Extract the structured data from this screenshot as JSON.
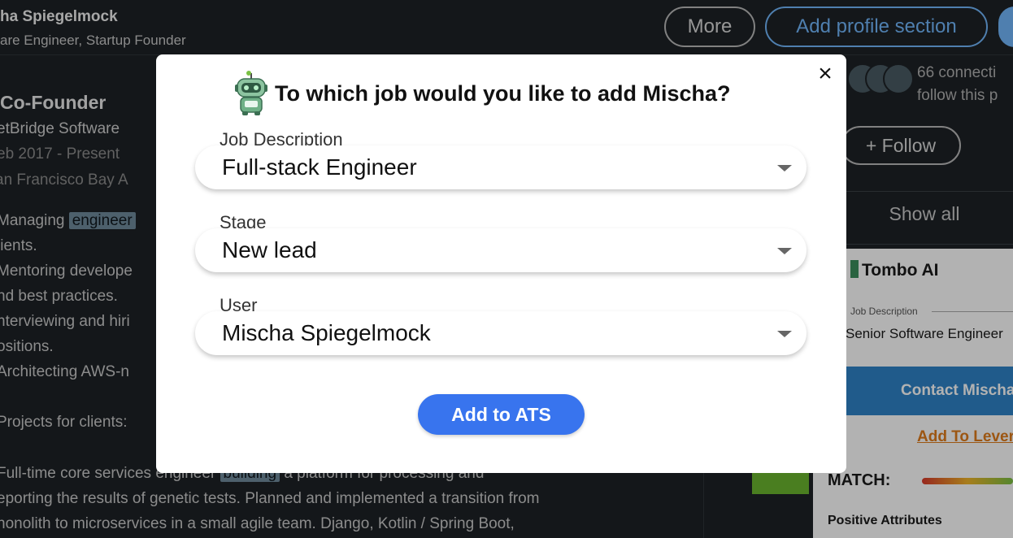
{
  "profile": {
    "name": "ha Spiegelmock",
    "headline": "are Engineer, Startup Founder",
    "more_label": "More",
    "add_section_label": "Add profile section"
  },
  "experience": {
    "title": "Co-Founder",
    "company": "etBridge Software",
    "dates": "eb 2017 - Present",
    "location": "an Francisco Bay A",
    "lines": [
      {
        "pre": "Managing ",
        "hl": "engineer",
        "post": ""
      },
      {
        "pre": "lients.",
        "hl": "",
        "post": ""
      },
      {
        "pre": "Mentoring develope",
        "hl": "",
        "post": ""
      },
      {
        "pre": "nd best practices.",
        "hl": "",
        "post": ""
      },
      {
        "pre": "nterviewing and hiri",
        "hl": "",
        "post": ""
      },
      {
        "pre": "ositions.",
        "hl": "",
        "post": ""
      },
      {
        "pre": "Architecting AWS-n",
        "hl": "",
        "post": ""
      },
      {
        "pre": "",
        "hl": "",
        "post": ""
      },
      {
        "pre": "Projects for clients:",
        "hl": "",
        "post": ""
      },
      {
        "pre": "",
        "hl": "",
        "post": ""
      },
      {
        "pre": " Full-time core services engineer ",
        "hl": "building",
        "post": " a platform for processing and"
      },
      {
        "pre": "eporting the results of genetic tests. Planned and implemented a transition from",
        "hl": "",
        "post": ""
      },
      {
        "pre": "nonolith to microservices in a small agile team. Django, Kotlin / Spring Boot,",
        "hl": "",
        "post": ""
      }
    ]
  },
  "sidebar": {
    "connections_line1": "66 connecti",
    "connections_line2": "follow this p",
    "follow_label": "+ Follow",
    "show_all_label": "Show all"
  },
  "extension": {
    "brand": "Tombo AI",
    "jd_label": "Job Description",
    "jd_value": "Senior Software Engineer",
    "contact_label": "Contact Mischa",
    "lever_label": "Add To Lever",
    "match_label": "MATCH:",
    "positive_label": "Positive Attributes"
  },
  "modal": {
    "title": "To which job would you like to add Mischa?",
    "close_symbol": "×",
    "fields": {
      "job_description": {
        "label": "Job Description",
        "value": "Full-stack Engineer"
      },
      "stage": {
        "label": "Stage",
        "value": "New lead"
      },
      "user": {
        "label": "User",
        "value": "Mischa Spiegelmock"
      }
    },
    "submit_label": "Add to ATS"
  },
  "colors": {
    "primary_button": "#3874ee",
    "link_blue": "#71b7fb",
    "lever_orange": "#e07b1a",
    "contact_blue": "#2e83c7"
  }
}
